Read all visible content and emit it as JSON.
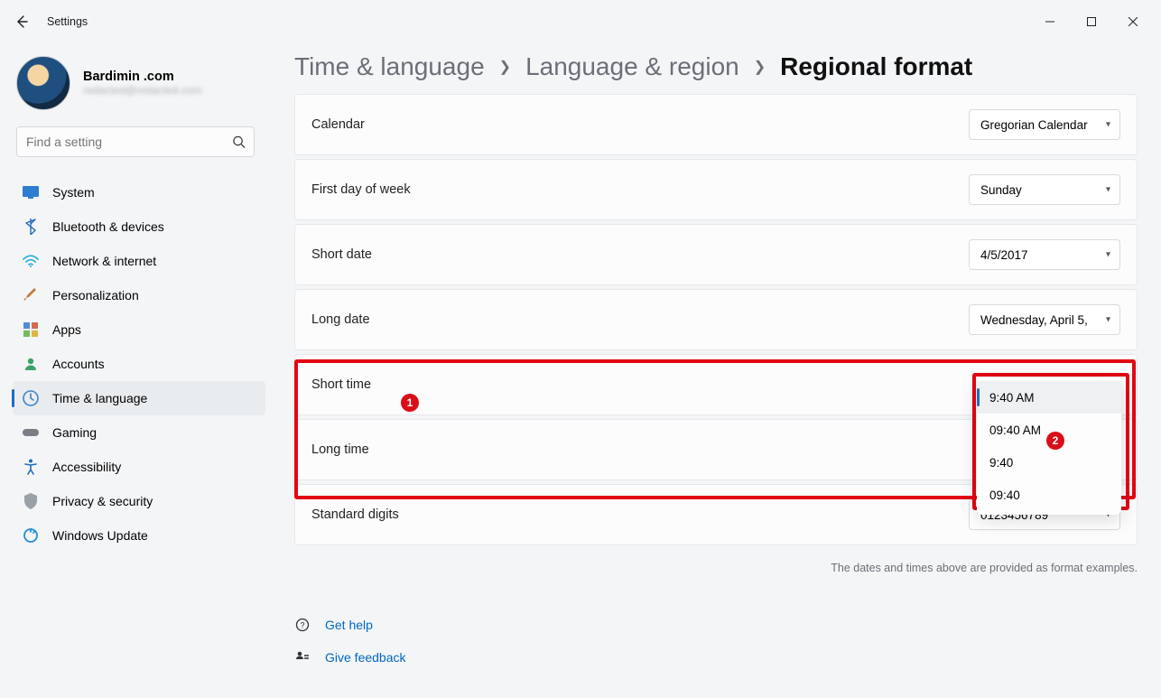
{
  "window": {
    "title": "Settings"
  },
  "profile": {
    "name": "Bardimin .com",
    "email_blur": "redacted@redacted.com"
  },
  "search": {
    "placeholder": "Find a setting"
  },
  "sidebar": {
    "items": [
      {
        "label": "System"
      },
      {
        "label": "Bluetooth & devices"
      },
      {
        "label": "Network & internet"
      },
      {
        "label": "Personalization"
      },
      {
        "label": "Apps"
      },
      {
        "label": "Accounts"
      },
      {
        "label": "Time & language"
      },
      {
        "label": "Gaming"
      },
      {
        "label": "Accessibility"
      },
      {
        "label": "Privacy & security"
      },
      {
        "label": "Windows Update"
      }
    ]
  },
  "breadcrumbs": {
    "a": "Time & language",
    "b": "Language & region",
    "c": "Regional format"
  },
  "rows": {
    "calendar": {
      "label": "Calendar",
      "value": "Gregorian Calendar"
    },
    "first_day": {
      "label": "First day of week",
      "value": "Sunday"
    },
    "short_date": {
      "label": "Short date",
      "value": "4/5/2017"
    },
    "long_date": {
      "label": "Long date",
      "value": "Wednesday, April 5,"
    },
    "short_time": {
      "label": "Short time"
    },
    "long_time": {
      "label": "Long time"
    },
    "standard_digits": {
      "label": "Standard digits",
      "value": "0123456789"
    }
  },
  "short_time_options": {
    "o0": "9:40 AM",
    "o1": "09:40 AM",
    "o2": "9:40",
    "o3": "09:40"
  },
  "note": "The dates and times above are provided as format examples.",
  "links": {
    "help": "Get help",
    "feedback": "Give feedback"
  },
  "annotations": {
    "badge1": "1",
    "badge2": "2"
  }
}
